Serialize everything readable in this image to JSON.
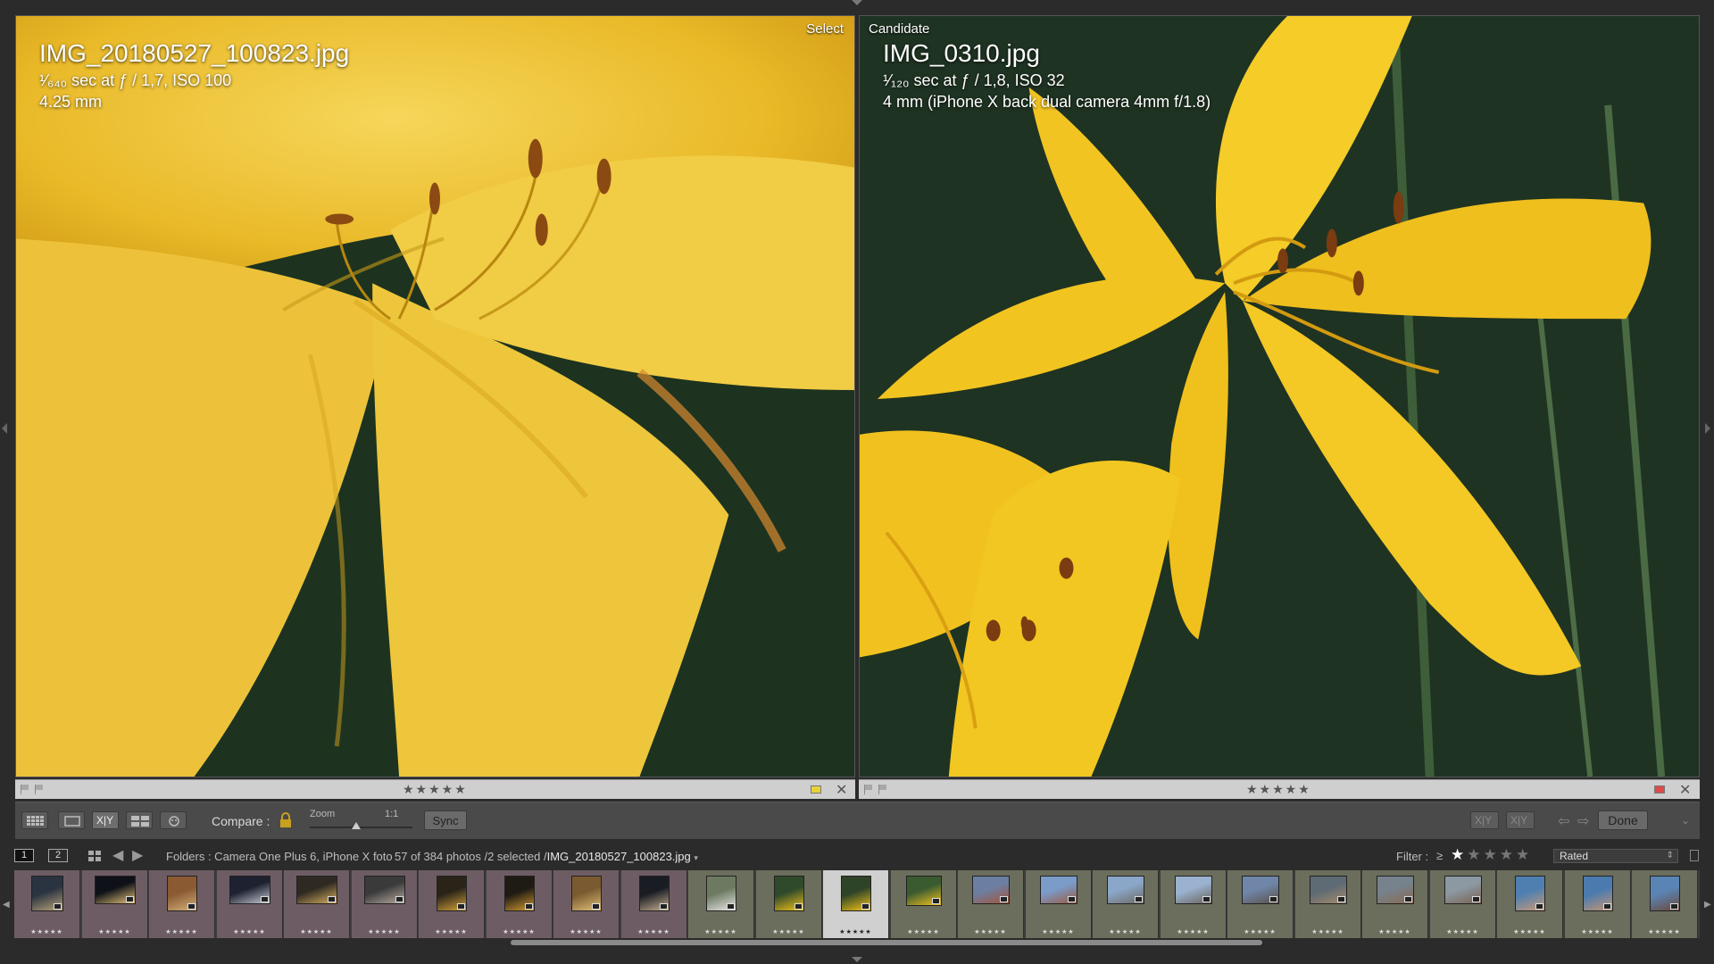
{
  "left_pane": {
    "tag": "Select",
    "filename": "IMG_20180527_100823.jpg",
    "exposure": "¹⁄₆₄₀ sec at ƒ / 1,7, ISO 100",
    "focal": "4.25 mm",
    "rating_stars": "★★★★★",
    "color_label": "#e6d23a"
  },
  "right_pane": {
    "tag": "Candidate",
    "filename": "IMG_0310.jpg",
    "exposure": "¹⁄₁₂₀ sec at ƒ / 1,8, ISO 32",
    "focal": "4 mm (iPhone X back dual camera 4mm f/1.8)",
    "rating_stars": "★★★★★",
    "color_label": "#e04a4a"
  },
  "toolbar": {
    "compare_label": "Compare :",
    "zoom_label": "Zoom",
    "zoom_ratio": "1:1",
    "zoom_level": 0.45,
    "sync_label": "Sync",
    "done_label": "Done",
    "swap_label": "X|Y",
    "make_select_label": "X|Y"
  },
  "filmbar": {
    "page1": "1",
    "page2": "2",
    "folders": "Folders : Camera One Plus 6, iPhone X foto",
    "count": "57 of 384 photos /2 selected /",
    "current_file": "IMG_20180527_100823.jpg",
    "caret": "▾",
    "filter_label": "Filter :",
    "filter_op": "≥",
    "filter_stars": 1,
    "filter_mode": "Rated"
  },
  "filmstrip": {
    "cell_stars": "★★★★★",
    "thumbnails": [
      {
        "name": "night-fountain",
        "bg": "pink",
        "fill": "#2a3340",
        "accent": "#b9a37a",
        "w": 36,
        "h": 40
      },
      {
        "name": "night-building",
        "bg": "pink",
        "fill": "#0e1118",
        "accent": "#e8c27a",
        "w": 46,
        "h": 32
      },
      {
        "name": "arch-doorway",
        "bg": "pink",
        "fill": "#8a5a32",
        "accent": "#d6b07a",
        "w": 34,
        "h": 40
      },
      {
        "name": "night-street",
        "bg": "pink",
        "fill": "#1d2130",
        "accent": "#c8cbd6",
        "w": 46,
        "h": 32
      },
      {
        "name": "night-alley",
        "bg": "pink",
        "fill": "#2e2a22",
        "accent": "#d9b060",
        "w": 46,
        "h": 32
      },
      {
        "name": "tunnel",
        "bg": "pink",
        "fill": "#3a3a3a",
        "accent": "#b8aaa0",
        "w": 46,
        "h": 32
      },
      {
        "name": "night-lights-1",
        "bg": "pink",
        "fill": "#2a2418",
        "accent": "#d4a23a",
        "w": 34,
        "h": 40
      },
      {
        "name": "night-lights-2",
        "bg": "pink",
        "fill": "#1e1a14",
        "accent": "#d49a30",
        "w": 34,
        "h": 40
      },
      {
        "name": "gold-texture",
        "bg": "pink",
        "fill": "#7a5a30",
        "accent": "#e0c078",
        "w": 34,
        "h": 40
      },
      {
        "name": "night-plaza",
        "bg": "pink",
        "fill": "#1a1c24",
        "accent": "#c7b090",
        "w": 34,
        "h": 40
      },
      {
        "name": "white-dog",
        "bg": "green",
        "fill": "#6d7a62",
        "accent": "#e8e8e8",
        "w": 34,
        "h": 40
      },
      {
        "name": "lily-1",
        "bg": "green",
        "fill": "#2f4a2a",
        "accent": "#f2c21a",
        "w": 34,
        "h": 40
      },
      {
        "name": "lily-selected",
        "bg": "sel",
        "fill": "#2e4428",
        "accent": "#f5c518",
        "w": 34,
        "h": 40
      },
      {
        "name": "lily-2",
        "bg": "green",
        "fill": "#3a5a30",
        "accent": "#f3c21e",
        "w": 40,
        "h": 34
      },
      {
        "name": "red-roofs",
        "bg": "green",
        "fill": "#6c7fa3",
        "accent": "#a4553a",
        "w": 42,
        "h": 32
      },
      {
        "name": "rooftops",
        "bg": "green",
        "fill": "#7b9bc8",
        "accent": "#9a5a40",
        "w": 42,
        "h": 32
      },
      {
        "name": "street-view-1",
        "bg": "green",
        "fill": "#8aa6c8",
        "accent": "#6e6a64",
        "w": 42,
        "h": 32
      },
      {
        "name": "street-view-2",
        "bg": "green",
        "fill": "#9ab2cf",
        "accent": "#6a645c",
        "w": 42,
        "h": 32
      },
      {
        "name": "old-town-1",
        "bg": "green",
        "fill": "#6f86a8",
        "accent": "#5a5048",
        "w": 42,
        "h": 32
      },
      {
        "name": "old-town-2",
        "bg": "green",
        "fill": "#5e6a74",
        "accent": "#a68a6a",
        "w": 42,
        "h": 32
      },
      {
        "name": "old-town-3",
        "bg": "green",
        "fill": "#76828c",
        "accent": "#8a6a52",
        "w": 42,
        "h": 32
      },
      {
        "name": "old-town-4",
        "bg": "green",
        "fill": "#8c98a2",
        "accent": "#7a6250",
        "w": 42,
        "h": 32
      },
      {
        "name": "portrait-1",
        "bg": "green",
        "fill": "#4f7fb0",
        "accent": "#c89a78",
        "w": 34,
        "h": 40
      },
      {
        "name": "portrait-2",
        "bg": "green",
        "fill": "#4a7aae",
        "accent": "#c49674",
        "w": 34,
        "h": 40
      },
      {
        "name": "portrait-3",
        "bg": "green",
        "fill": "#5a84b4",
        "accent": "#6b4a3a",
        "w": 34,
        "h": 40
      }
    ]
  }
}
